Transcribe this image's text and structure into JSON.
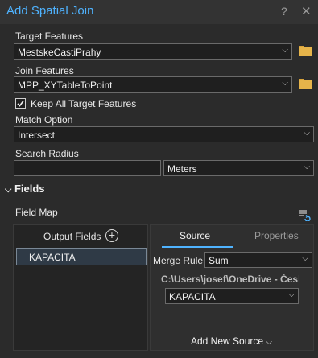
{
  "window": {
    "title": "Add Spatial Join",
    "help_glyph": "?",
    "close_glyph": "✕"
  },
  "target_features": {
    "label": "Target Features",
    "value": "MestskeCastiPrahy"
  },
  "join_features": {
    "label": "Join Features",
    "value": "MPP_XYTableToPoint"
  },
  "keep_all": {
    "label": "Keep All Target Features",
    "checked": true
  },
  "match_option": {
    "label": "Match Option",
    "value": "Intersect"
  },
  "search_radius": {
    "label": "Search Radius",
    "value": "",
    "unit": "Meters"
  },
  "fields_section": {
    "title": "Fields"
  },
  "field_map": {
    "label": "Field Map",
    "output_fields_header": "Output Fields",
    "output_fields": [
      "KAPACITA"
    ],
    "tabs": [
      "Source",
      "Properties"
    ],
    "active_tab": "Source",
    "merge_rule_label": "Merge Rule",
    "merge_rule_value": "Sum",
    "source_path": "C:\\Users\\josef\\OneDrive - Česká",
    "source_field": "KAPACITA",
    "add_new_source": "Add New Source"
  },
  "icons": {
    "browse": "folder-icon",
    "dropdown": "chevron-down-icon",
    "add_field": "plus-circle-icon",
    "field_map_options": "field-map-options-icon"
  },
  "colors": {
    "accent": "#4fb3ff",
    "background": "#2b2b2b",
    "selected_item": "#2f3a46"
  }
}
